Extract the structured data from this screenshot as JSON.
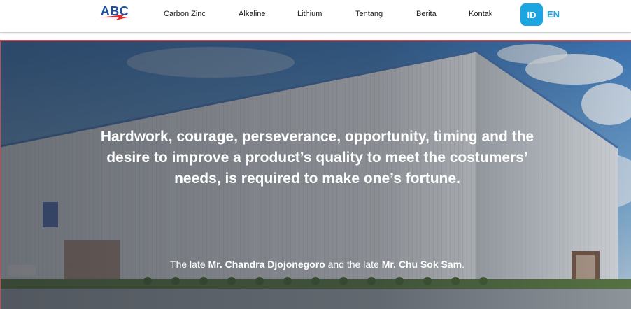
{
  "header": {
    "logo_text": "ABC",
    "nav": [
      {
        "label": "Carbon Zinc"
      },
      {
        "label": "Alkaline"
      },
      {
        "label": "Lithium"
      },
      {
        "label": "Tentang"
      },
      {
        "label": "Berita"
      },
      {
        "label": "Kontak"
      }
    ],
    "lang": {
      "id": "ID",
      "en": "EN",
      "active": "ID"
    }
  },
  "hero": {
    "quote": "Hardwork, courage, perseverance, opportunity, timing and the desire to improve a product’s quality to meet the costumers’ needs, is required to make one’s fortune.",
    "attribution": {
      "prefix1": "The late ",
      "name1": "Mr. Chandra Djojonegoro",
      "middle": " and the late ",
      "name2": "Mr. Chu Sok Sam",
      "suffix": "."
    }
  },
  "colors": {
    "brand_blue": "#1f4fa1",
    "brand_red": "#e4262d",
    "accent": "#1ba5e1"
  }
}
